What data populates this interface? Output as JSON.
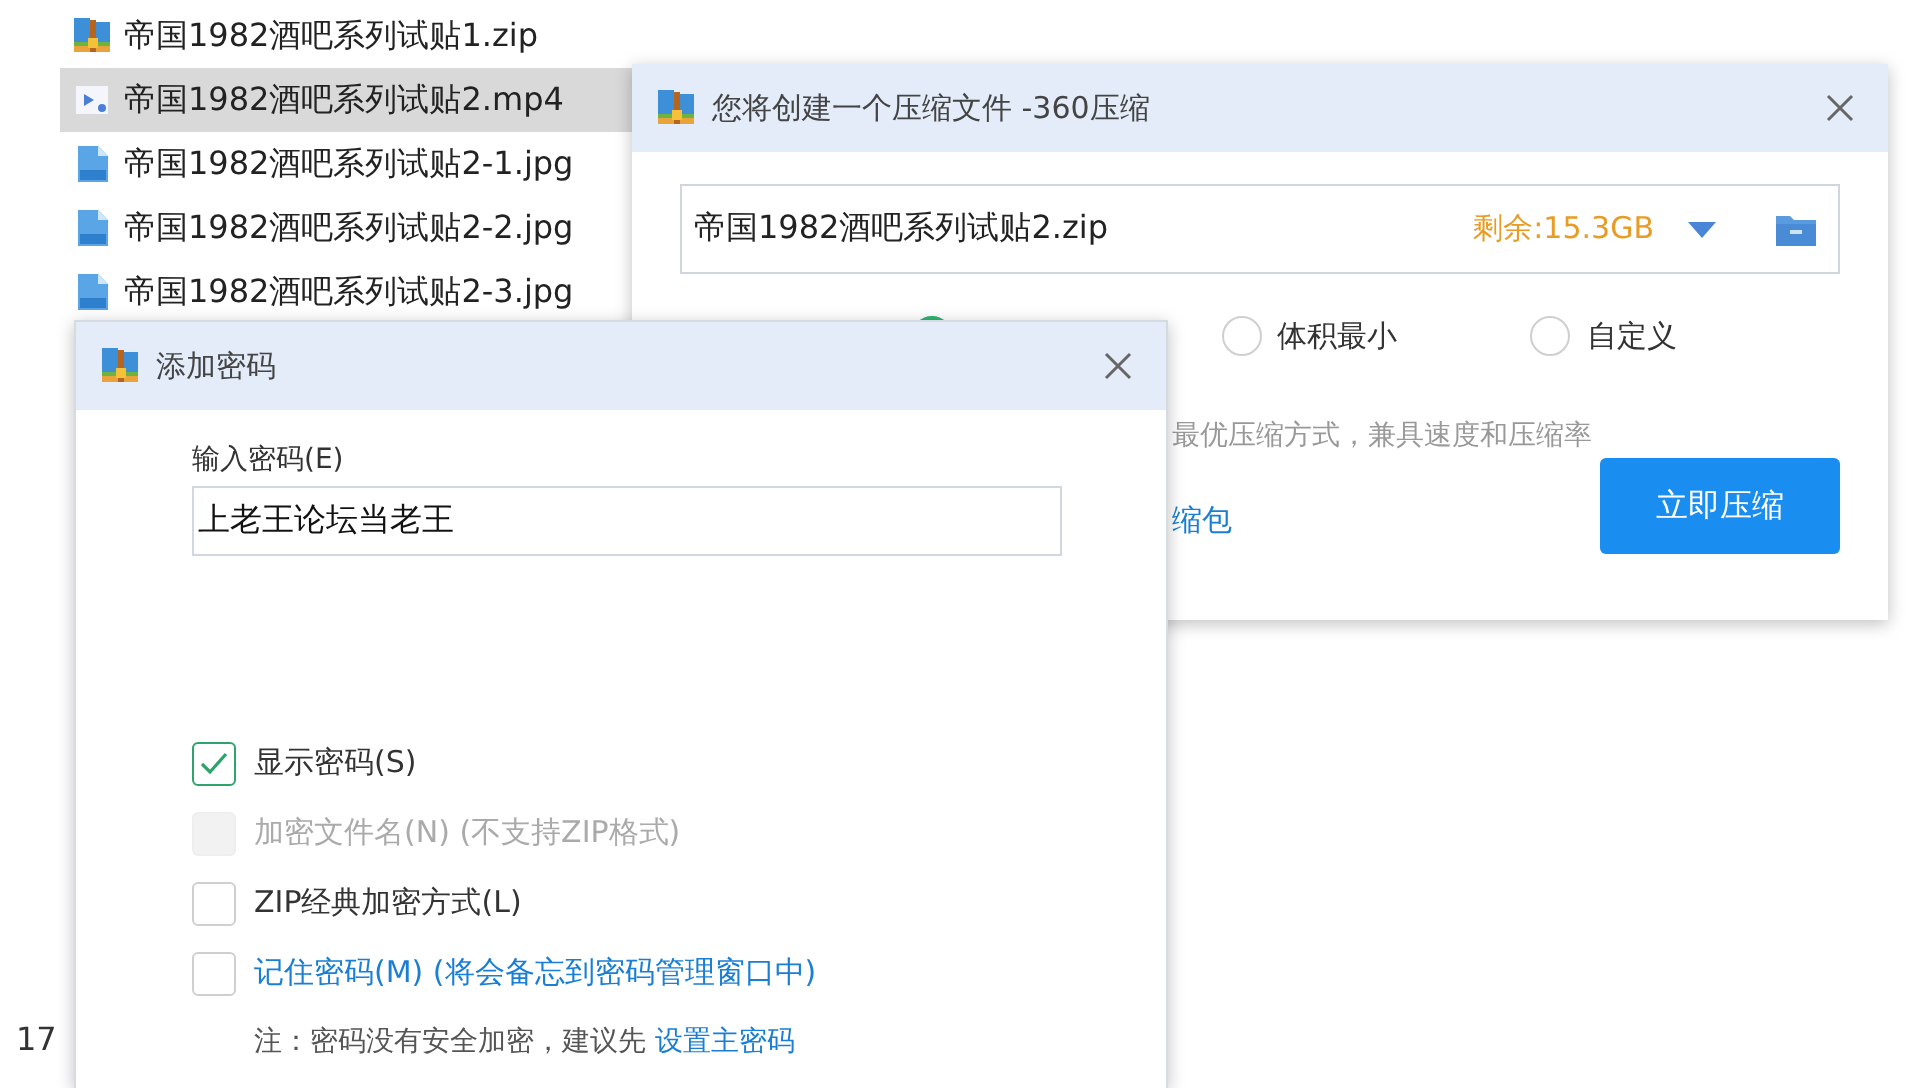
{
  "files": [
    {
      "name": "帝国1982酒吧系列试贴1.zip",
      "kind": "zip",
      "selected": false
    },
    {
      "name": "帝国1982酒吧系列试贴2.mp4",
      "kind": "video",
      "selected": true
    },
    {
      "name": "帝国1982酒吧系列试贴2-1.jpg",
      "kind": "jpg",
      "selected": false
    },
    {
      "name": "帝国1982酒吧系列试贴2-2.jpg",
      "kind": "jpg",
      "selected": false
    },
    {
      "name": "帝国1982酒吧系列试贴2-3.jpg",
      "kind": "jpg",
      "selected": false
    }
  ],
  "status_text": "17",
  "compress_dialog": {
    "title": "您将创建一个压缩文件 -360压缩",
    "path": "帝国1982酒吧系列试贴2.zip",
    "free_space": "剩余:15.3GB",
    "radios": [
      {
        "selected": true
      },
      {
        "label": "体积最小",
        "selected": false
      },
      {
        "label": "自定义",
        "selected": false
      }
    ],
    "description": "最优压缩方式，兼具速度和压缩率",
    "link": "缩包",
    "button": "立即压缩"
  },
  "password_dialog": {
    "title": "添加密码",
    "field_label": "输入密码(E)",
    "password": "上老王论坛当老王",
    "checkboxes": [
      {
        "label": "显示密码(S)",
        "checked": true,
        "disabled": false,
        "link": false
      },
      {
        "label": "加密文件名(N) (不支持ZIP格式)",
        "checked": false,
        "disabled": true,
        "link": false
      },
      {
        "label": "ZIP经典加密方式(L)",
        "checked": false,
        "disabled": false,
        "link": false
      },
      {
        "label": "记住密码(M) (将会备忘到密码管理窗口中)",
        "checked": false,
        "disabled": false,
        "link": true
      }
    ],
    "note": "注：密码没有安全加密，建议先",
    "note_link": "设置主密码"
  }
}
